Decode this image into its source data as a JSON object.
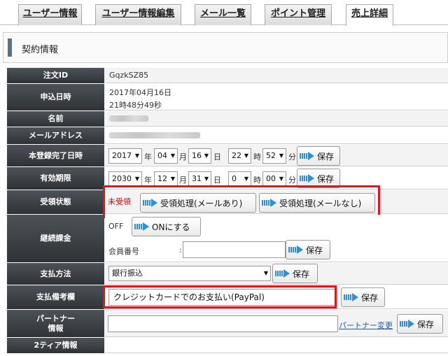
{
  "tabs": [
    {
      "label": "ユーザー情報"
    },
    {
      "label": "ユーザー情報編集"
    },
    {
      "label": "メール一覧"
    },
    {
      "label": "ポイント管理"
    },
    {
      "label": "売上詳細"
    }
  ],
  "active_tab": "売上詳細",
  "section_title": "契約情報",
  "order_id": {
    "label": "注文ID",
    "value": "GqzkSZ85"
  },
  "applied": {
    "label": "申込日時",
    "date": "2017年04月16日",
    "time": "21時48分49秒"
  },
  "name": {
    "label": "名前"
  },
  "email": {
    "label": "メールアドレス"
  },
  "registered": {
    "label": "本登録完了日時",
    "year": "2017",
    "month": "04",
    "day": "16",
    "hour": "22",
    "minute": "52",
    "u_year": "年",
    "u_month": "月",
    "u_day": "日",
    "u_hour": "時",
    "u_minute": "分",
    "save": "保存"
  },
  "expiry": {
    "label": "有効期限",
    "year": "2030",
    "month": "12",
    "day": "31",
    "hour": "0",
    "minute": "00",
    "u_year": "年",
    "u_month": "月",
    "u_day": "日",
    "u_hour": "時",
    "u_minute": "分",
    "save": "保存"
  },
  "receipt": {
    "label": "受領状態",
    "status": "未受領",
    "status_color": "#d40000",
    "btn_with_mail": "受領処理(メールあり)",
    "btn_without_mail": "受領処理(メールなし)"
  },
  "billing": {
    "label": "継続課金",
    "state": "OFF",
    "on_btn": "ONにする",
    "member_no_label": "会員番号",
    "colon": ":",
    "member_no_value": "",
    "save": "保存"
  },
  "payment": {
    "label": "支払方法",
    "selected": "銀行振込",
    "save": "保存"
  },
  "payment_note": {
    "label": "支払備考欄",
    "value": "クレジットカードでのお支払い(PayPal)",
    "save": "保存"
  },
  "partner": {
    "label_line1": "パートナー",
    "label_line2": "情報",
    "value": "",
    "change_link": "パートナー変更",
    "save": "保存"
  },
  "tier2": {
    "label": "2ティア情報"
  },
  "highlight_color": "#e0161b",
  "accent_color": "#2e8fd6",
  "icons": {
    "tab_arrow": "arrow-right-icon",
    "dropdown": "chevron-down-icon"
  }
}
